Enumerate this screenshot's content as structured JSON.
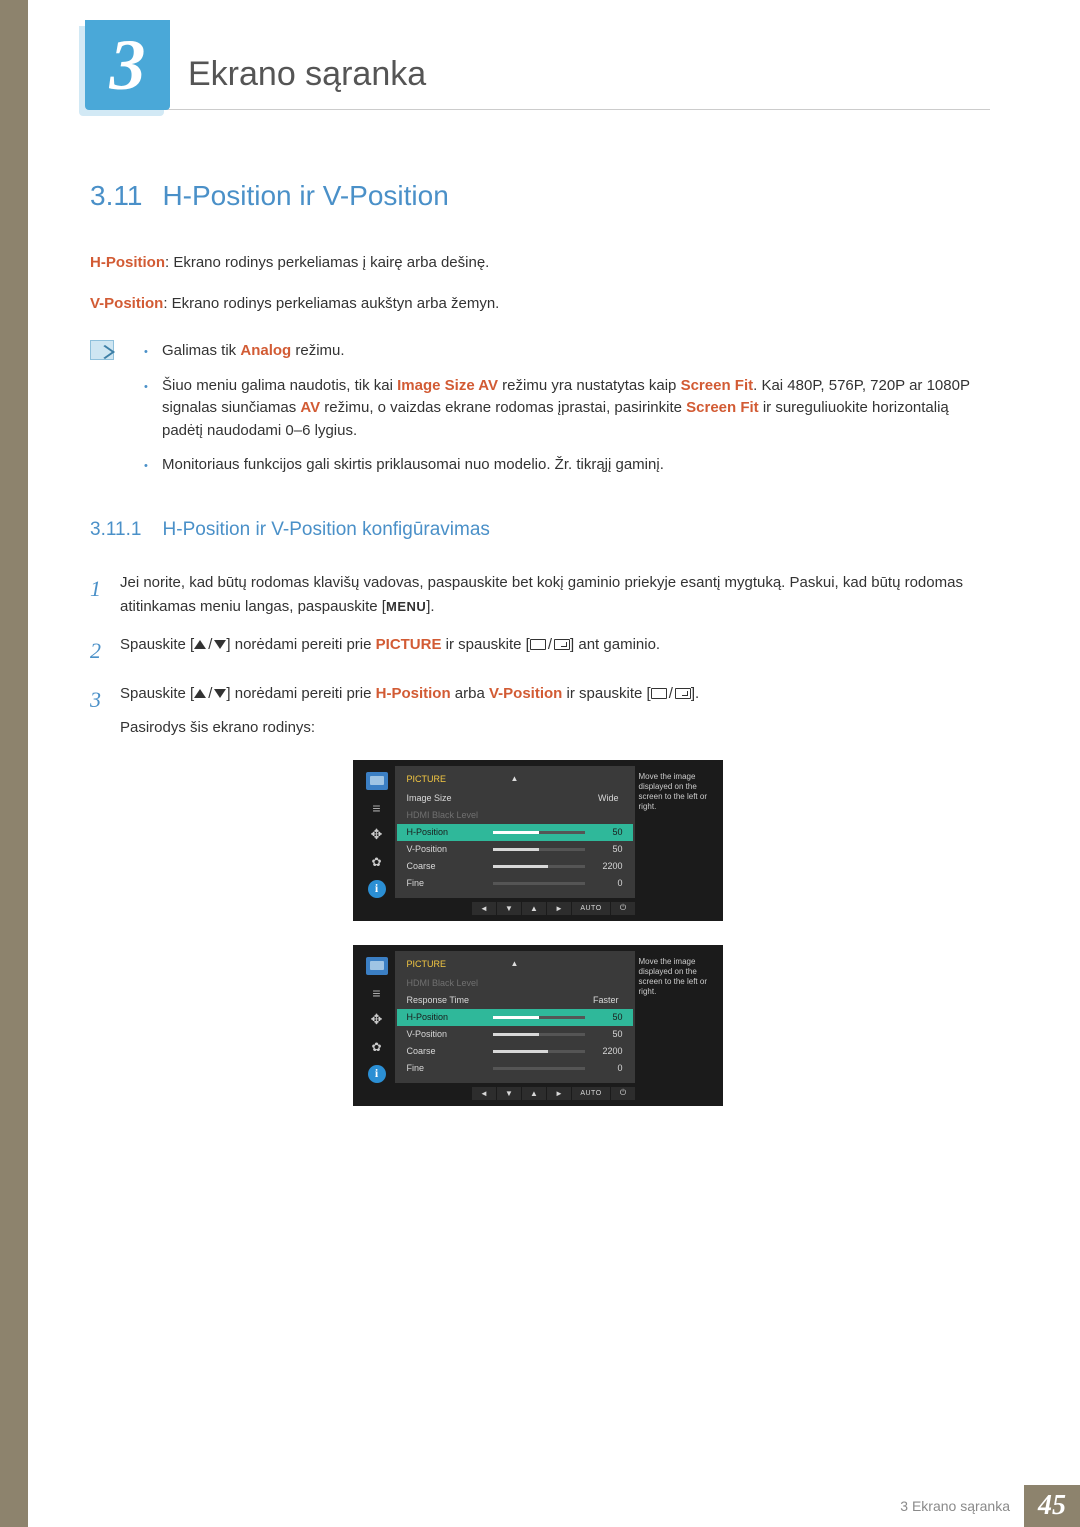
{
  "chapter": {
    "number": "3",
    "title": "Ekrano sąranka"
  },
  "section": {
    "number": "3.11",
    "title": "H-Position ir V-Position"
  },
  "paragraphs": {
    "hpos": {
      "term": "H-Position",
      "text": ": Ekrano rodinys perkeliamas į kairę arba dešinę."
    },
    "vpos": {
      "term": "V-Position",
      "text": ": Ekrano rodinys perkeliamas aukštyn arba žemyn."
    }
  },
  "notes": [
    {
      "pre": "Galimas tik ",
      "hl1": "Analog",
      "post1": " režimu."
    },
    {
      "pre": "Šiuo meniu galima naudotis, tik kai ",
      "hl1": "Image Size AV",
      "mid1": " režimu yra nustatytas kaip ",
      "hl2": "Screen Fit",
      "mid2": ". Kai 480P, 576P, 720P ar 1080P signalas siunčiamas ",
      "hl3": "AV",
      "mid3": " režimu, o vaizdas ekrane rodomas įprastai, pasirinkite ",
      "hl4": "Screen Fit",
      "post": " ir sureguliuokite horizontalią padėtį naudodami 0–6 lygius."
    },
    {
      "text": "Monitoriaus funkcijos gali skirtis priklausomai nuo modelio. Žr. tikrąjį gaminį."
    }
  ],
  "subsection": {
    "number": "3.11.1",
    "title": "H-Position ir V-Position konfigūravimas"
  },
  "steps": [
    {
      "n": "1",
      "text1": "Jei norite, kad būtų rodomas klavišų vadovas, paspauskite bet kokį gaminio priekyje esantį mygtuką. Paskui, kad būtų rodomas atitinkamas meniu langas, paspauskite [",
      "menu": "MENU",
      "text2": "]."
    },
    {
      "n": "2",
      "text1": "Spauskite [",
      "icons1": "updown",
      "text2": "] norėdami pereiti prie ",
      "hl": "PICTURE",
      "text3": " ir spauskite [",
      "icons2": "boxes",
      "text4": "] ant gaminio."
    },
    {
      "n": "3",
      "text1": "Spauskite [",
      "icons1": "updown",
      "text2": "] norėdami pereiti prie ",
      "hl": "H-Position",
      "text3": " arba ",
      "hl2": "V-Position",
      "text4": " ir spauskite [",
      "icons2": "boxes",
      "text5": "]."
    }
  ],
  "afterSteps": "Pasirodys šis ekrano rodinys:",
  "osd": {
    "title": "PICTURE",
    "help": "Move the image displayed on the screen to the left or right.",
    "nav": [
      "◄",
      "▼",
      "▲",
      "►",
      "AUTO",
      "⏻"
    ],
    "panel1": [
      {
        "label": "Image Size",
        "type": "text",
        "value": "Wide"
      },
      {
        "label": "HDMI Black Level",
        "type": "dim"
      },
      {
        "label": "H-Position",
        "type": "slider",
        "value": "50",
        "fill": 50,
        "hl": true
      },
      {
        "label": "V-Position",
        "type": "slider",
        "value": "50",
        "fill": 50
      },
      {
        "label": "Coarse",
        "type": "slider",
        "value": "2200",
        "fill": 60
      },
      {
        "label": "Fine",
        "type": "slider",
        "value": "0",
        "fill": 0
      }
    ],
    "panel2": [
      {
        "label": "HDMI Black Level",
        "type": "dim"
      },
      {
        "label": "Response Time",
        "type": "text",
        "value": "Faster"
      },
      {
        "label": "H-Position",
        "type": "slider",
        "value": "50",
        "fill": 50,
        "hl": true
      },
      {
        "label": "V-Position",
        "type": "slider",
        "value": "50",
        "fill": 50
      },
      {
        "label": "Coarse",
        "type": "slider",
        "value": "2200",
        "fill": 60
      },
      {
        "label": "Fine",
        "type": "slider",
        "value": "0",
        "fill": 0
      }
    ]
  },
  "footer": {
    "text": "3 Ekrano sąranka",
    "page": "45"
  }
}
